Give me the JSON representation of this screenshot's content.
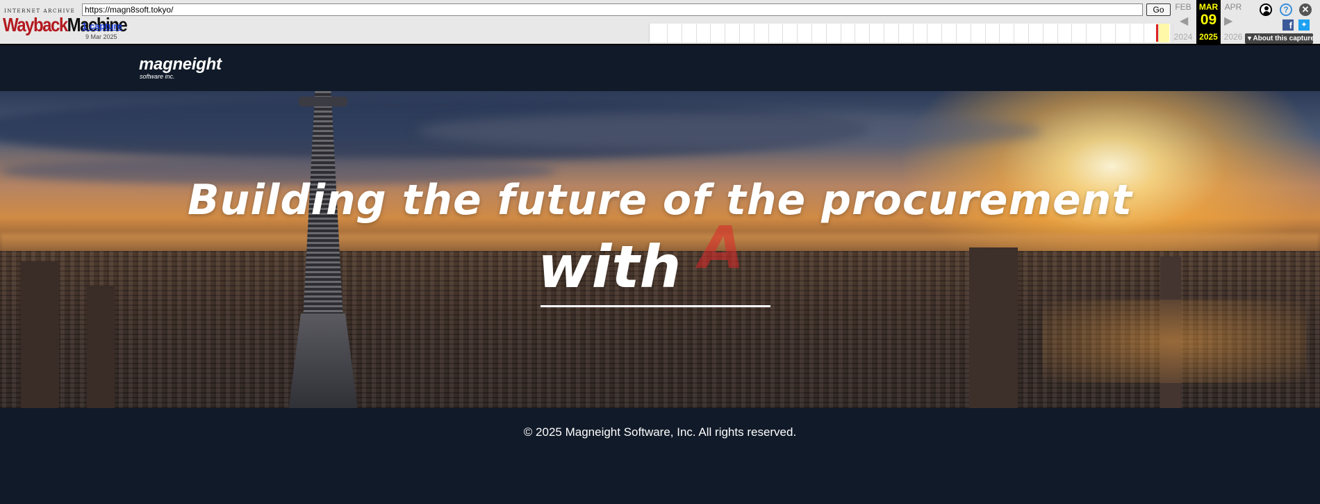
{
  "wayback": {
    "logo_top": "INTERNET ARCHIVE",
    "logo_wayback": "Wayback",
    "logo_machine": "Machine",
    "url": "https://magn8soft.tokyo/",
    "go_label": "Go",
    "captures_link": "1 capture",
    "capture_date": "9 Mar 2025",
    "prev_month": "FEB",
    "prev_year": "2024",
    "current_month": "MAR",
    "current_day": "09",
    "current_year": "2025",
    "next_month": "APR",
    "next_year": "2026",
    "about_label": "About this capture",
    "icons": [
      "user-icon",
      "help-icon",
      "close-icon",
      "facebook-icon",
      "twitter-icon"
    ],
    "highlight_color": "#fff8a8",
    "current_bg": "#000000",
    "current_fg": "#ffff00"
  },
  "site": {
    "logo_name": "magneight",
    "logo_sub": "software inc.",
    "hero": {
      "headline": "Building the future of the procurement",
      "with_word": "with",
      "typed_char": "A"
    },
    "footer": {
      "copyright": "© 2025 Magneight Software, Inc. All rights reserved."
    },
    "colors": {
      "background": "#111a28",
      "text": "#ffffff",
      "typed_accent": "#dc2828"
    }
  }
}
